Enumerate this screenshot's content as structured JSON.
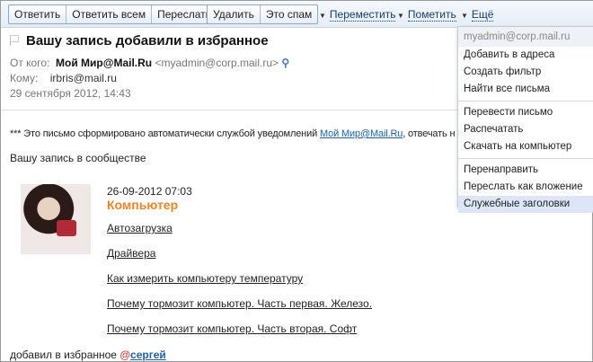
{
  "toolbar": {
    "reply": "Ответить",
    "reply_all": "Ответить всем",
    "forward": "Переслать",
    "delete": "Удалить",
    "spam": "Это спам",
    "move": "Переместить",
    "mark": "Пометить",
    "more": "Ещё"
  },
  "message": {
    "subject": "Вашу запись добавили в избранное",
    "from_label": "От кого:",
    "from_name": "Мой Мир@Mail.Ru",
    "from_email": "<myadmin@corp.mail.ru>",
    "to_label": "Кому:",
    "to": "irbris@mail.ru",
    "date": "29 сентября 2012, 14:43"
  },
  "body": {
    "notice_prefix": "*** Это письмо сформировано автоматически службой уведомлений ",
    "notice_link": "Мой Мир@Mail.Ru",
    "notice_suffix": ", отвечать н",
    "intro": "Вашу запись в сообществе",
    "post_date": "26-09-2012 07:03",
    "community": "Компьютер",
    "links": [
      "Автозагрузка",
      "Драйвера",
      "Как измерить компьютеру температуру",
      "Почему тормозит компьютер. Часть первая. Железо.",
      "Почему тормозит компьютер. Часть вторая. Софт"
    ],
    "footer_text": "добавил в избранное",
    "footer_user": "сергей"
  },
  "menu": {
    "header": "myadmin@corp.mail.ru",
    "group1": [
      "Добавить в адреса",
      "Создать фильтр",
      "Найти все письма"
    ],
    "group2": [
      "Перевести письмо",
      "Распечатать",
      "Скачать на компьютер"
    ],
    "group3": [
      "Перенаправить",
      "Переслать как вложение",
      "Служебные заголовки"
    ]
  }
}
